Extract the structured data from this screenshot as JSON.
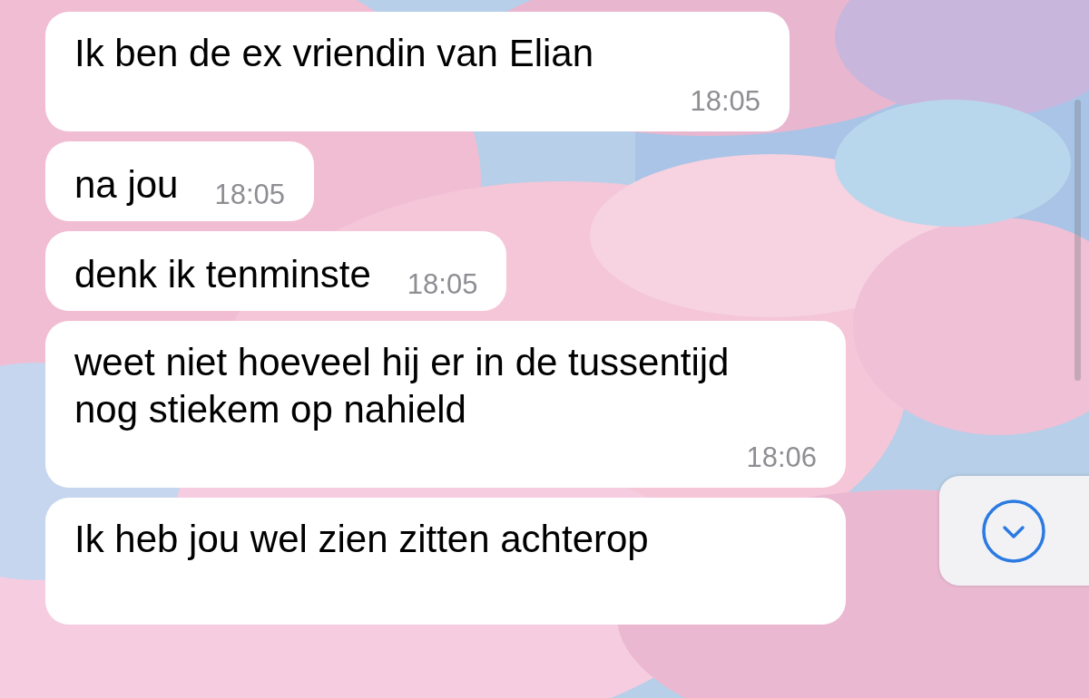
{
  "messages": [
    {
      "text": "Ik ben de ex vriendin van Elian",
      "time": "18:05",
      "kind": "stacked"
    },
    {
      "text": "na jou",
      "time": "18:05",
      "kind": "inline"
    },
    {
      "text": "denk ik tenminste",
      "time": "18:05",
      "kind": "inline"
    },
    {
      "text": "weet niet hoeveel hij er in de tussentijd nog stiekem op nahield",
      "time": "18:06",
      "kind": "stacked"
    },
    {
      "text": "Ik heb jou wel zien zitten achterop",
      "kind": "cut"
    }
  ]
}
